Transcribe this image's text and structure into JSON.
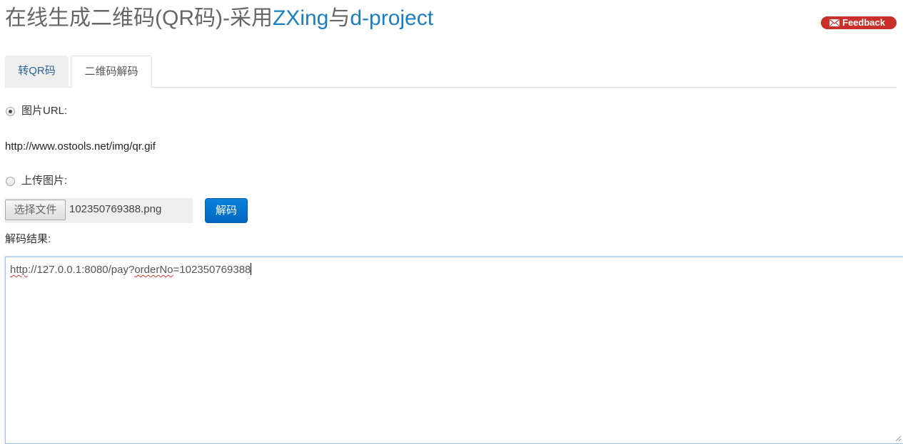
{
  "header": {
    "title_part1": "在线生成二维码(QR码)-采用",
    "title_zxing": "ZXing",
    "title_mid": "与",
    "title_dproject": "d-project",
    "feedback_label": "Feedback",
    "feedback_icon": "mail-icon"
  },
  "tabs": [
    {
      "label": "转QR码",
      "active": false
    },
    {
      "label": "二维码解码",
      "active": true
    }
  ],
  "decode_form": {
    "image_url_label": "图片URL:",
    "image_url_selected": true,
    "image_url_value": "http://www.ostools.net/img/qr.gif",
    "upload_label": "上传图片:",
    "upload_selected": false,
    "choose_file_label": "选择文件",
    "chosen_file_name": "102350769388.png",
    "decode_button_label": "解码",
    "result_label": "解码结果:",
    "result_parts": {
      "p1": "http",
      "p2": "://127.0.0.1:8080/pay?",
      "p3": "orderNo",
      "p4": "=102350769388"
    }
  },
  "colors": {
    "accent_link": "#1a7fc1",
    "feedback_bg": "#c9302c",
    "decode_button_bg": "#0067c1",
    "spell_check_underline": "#e0362c"
  }
}
